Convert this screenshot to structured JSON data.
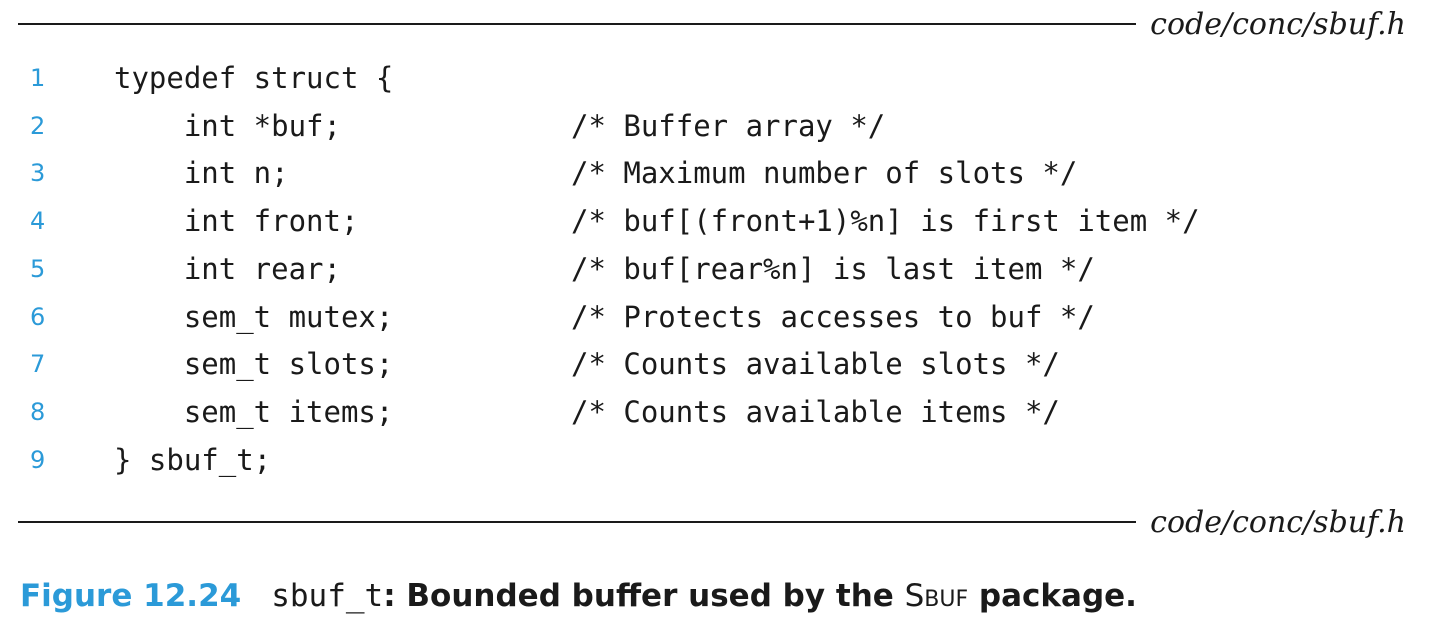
{
  "header_file": "code/conc/sbuf.h",
  "footer_file": "code/conc/sbuf.h",
  "code_lines": [
    {
      "num": "1",
      "code": "typedef struct {",
      "comment": ""
    },
    {
      "num": "2",
      "code": "    int *buf;",
      "comment": "/* Buffer array */"
    },
    {
      "num": "3",
      "code": "    int n;",
      "comment": "/* Maximum number of slots */"
    },
    {
      "num": "4",
      "code": "    int front;",
      "comment": "/* buf[(front+1)%n] is first item */"
    },
    {
      "num": "5",
      "code": "    int rear;",
      "comment": "/* buf[rear%n] is last item */"
    },
    {
      "num": "6",
      "code": "    sem_t mutex;",
      "comment": "/* Protects accesses to buf */"
    },
    {
      "num": "7",
      "code": "    sem_t slots;",
      "comment": "/* Counts available slots */"
    },
    {
      "num": "8",
      "code": "    sem_t items;",
      "comment": "/* Counts available items */"
    },
    {
      "num": "9",
      "code": "} sbuf_t;",
      "comment": ""
    }
  ],
  "caption": {
    "label": "Figure 12.24",
    "code_name": "sbuf_t",
    "colon": ":",
    "text_before": " Bounded buffer used by the ",
    "package": "Sbuf",
    "text_after": " package."
  }
}
